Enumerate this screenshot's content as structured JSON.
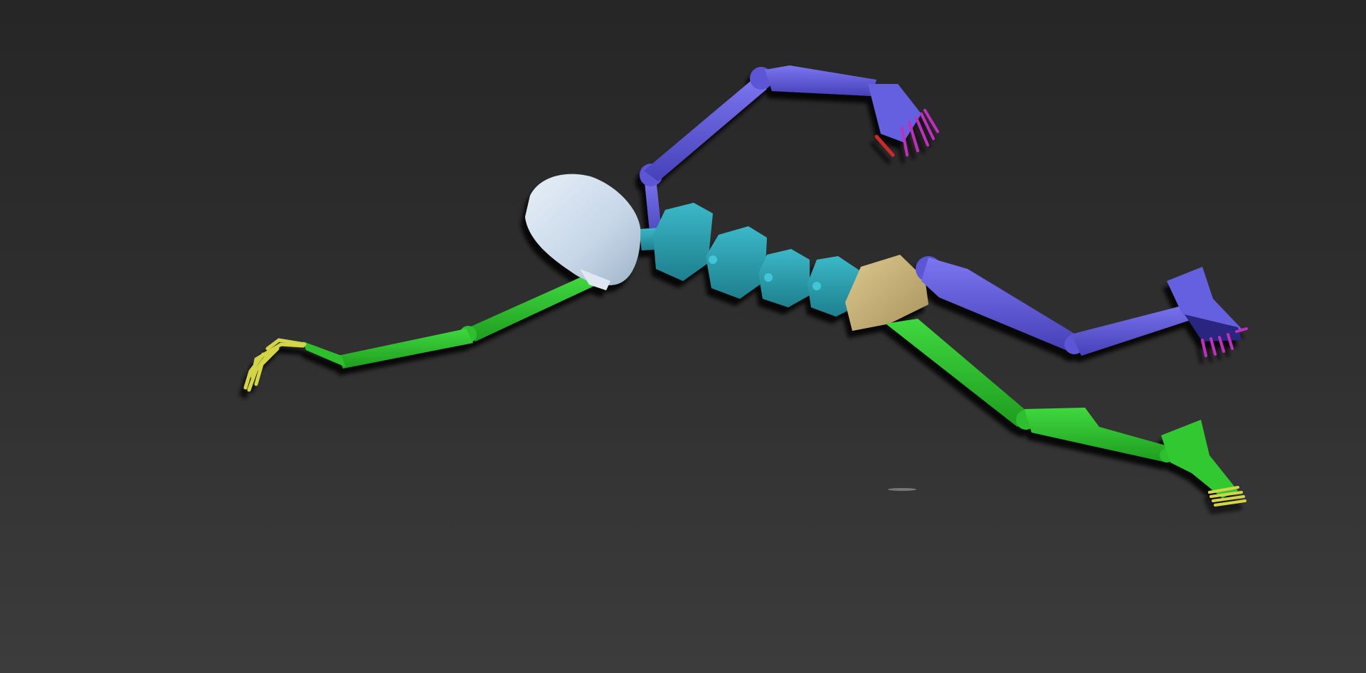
{
  "viewport": {
    "label": "perspective-viewport",
    "background_top": "#262626",
    "background_bottom": "#3c3c3c"
  },
  "rig": {
    "name": "biped-skeleton",
    "colors": {
      "head": "#c6d6e8",
      "spine": "#2a9fb0",
      "pelvis": "#c8b37a",
      "arm_left": "#2fbf2f",
      "arm_right": "#5b55d6",
      "leg_left": "#2fbf2f",
      "leg_right": "#5b55d6",
      "fingers_left": "#d4d44a",
      "fingers_right": "#c02fc0",
      "toes_left": "#d4d44a",
      "toes_right": "#c02fc0",
      "thumb_right": "#cc2a2a"
    }
  }
}
